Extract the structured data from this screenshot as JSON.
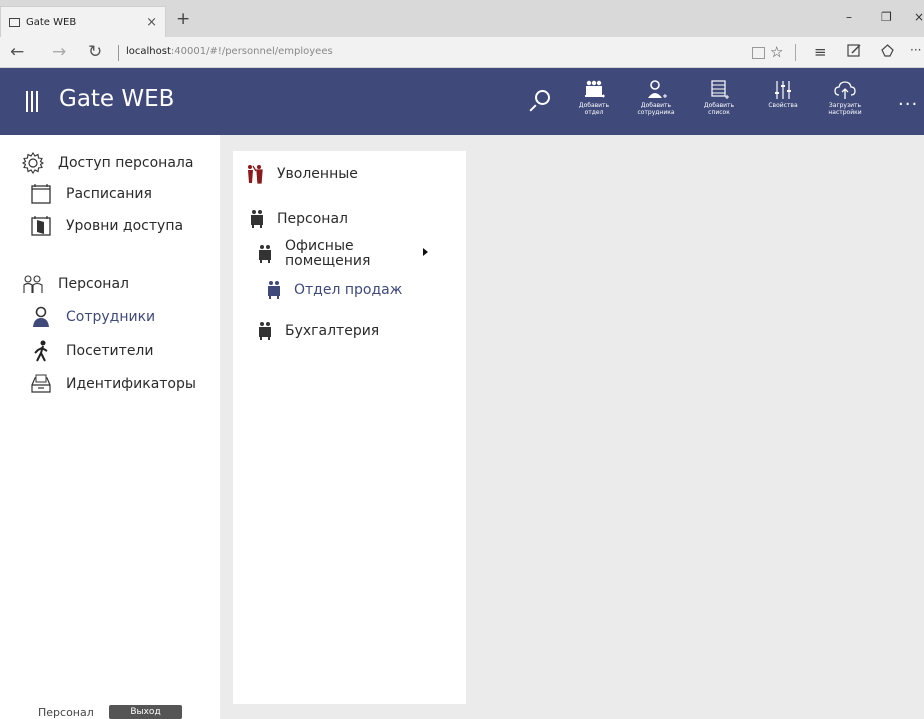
{
  "browser": {
    "tab_title": "Gate WEB",
    "tab_close": "×",
    "new_tab": "+",
    "url_host": "localhost",
    "url_rest": ":40001/#!/personnel/employees",
    "back": "←",
    "forward": "→",
    "refresh": "↻",
    "minimize": "–",
    "restore": "❐",
    "close": "×",
    "favorite": "☆",
    "hub": "≡",
    "overflow": "···"
  },
  "header": {
    "app_title": "Gate WEB",
    "buttons": [
      {
        "label": "Добавить\nотдел",
        "icon": "add-department-icon"
      },
      {
        "label": "Добавить\nсотрудника",
        "icon": "add-employee-icon"
      },
      {
        "label": "Добавить\nсписок",
        "icon": "add-list-icon"
      },
      {
        "label": "Свойства",
        "icon": "properties-icon"
      },
      {
        "label": "Загрузить\nнастройки",
        "icon": "upload-settings-icon"
      }
    ],
    "more": "···"
  },
  "sidebar": {
    "section_access": "Доступ персонала",
    "schedules": "Расписания",
    "access_levels": "Уровни доступа",
    "section_personnel": "Персонал",
    "employees": "Сотрудники",
    "visitors": "Посетители",
    "identifiers": "Идентификаторы",
    "footer_user": "Персонал",
    "footer_exit": "Выход"
  },
  "tree": {
    "dismissed": "Уволенные",
    "personnel": "Персонал",
    "office_line1": "Офисные",
    "office_line2": "помещения",
    "sales": "Отдел продаж",
    "accounting": "Бухгалтерия"
  },
  "colors": {
    "header_bg": "#3f4a7b",
    "accent": "#3f4a7b",
    "dismissed_icon": "#8b1a1a"
  }
}
